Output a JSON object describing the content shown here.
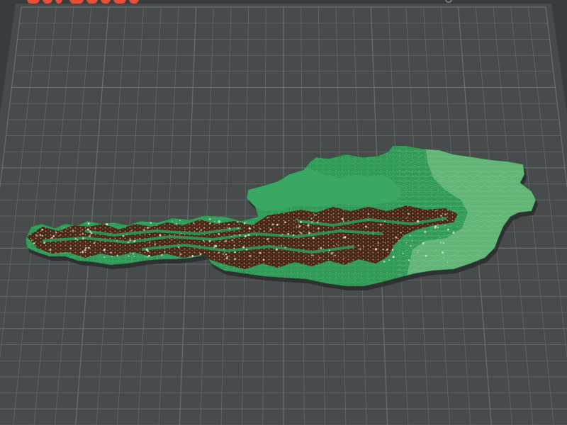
{
  "viewport": {
    "bed_color": "#484b4c",
    "grid_color": "#6d7173",
    "background_color": "#393c3d"
  },
  "model": {
    "colors": {
      "mountain": "#4a2616",
      "dark_green": "#2f9a56",
      "mid_green": "#3aa863",
      "light_green": "#63b677",
      "snow": "#e9e4dc",
      "shadow": "#2a2c2d"
    }
  },
  "brand": {
    "logo_icon": "brand-logo-icon",
    "logo_color": "#e2503a"
  },
  "controls": {
    "handle_icon": "drag-handle-icon"
  }
}
